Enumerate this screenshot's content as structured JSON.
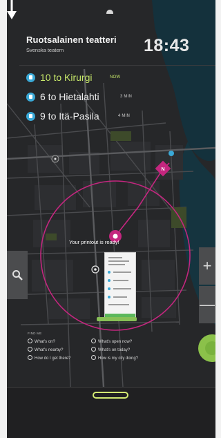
{
  "header": {
    "stop_name": "Ruotsalainen teatteri",
    "stop_name_sv": "Svenska teatern",
    "time": "18:43"
  },
  "departures": [
    {
      "line": "10 to Kirurgi",
      "when": "NOW",
      "mode": "tram"
    },
    {
      "line": "6 to Hietalahti",
      "when": "3 MIN",
      "mode": "tram"
    },
    {
      "line": "9 to Itä-Pasila",
      "when": "4 MIN",
      "mode": "tram"
    }
  ],
  "print": {
    "message": "Your printout is ready!"
  },
  "zoom": {
    "in_label": "+",
    "out_label": "—"
  },
  "help": {
    "title": "FIND ME",
    "items": [
      "What's on?",
      "What's nearby?",
      "How do I get there?",
      "What's open now?",
      "What's on today?",
      "How is my city doing?"
    ]
  },
  "colors": {
    "accent_green": "#c7e86a",
    "tram_blue": "#3aa9d7",
    "route_magenta": "#c4267f",
    "water": "#14313c"
  },
  "icons": {
    "search": "search-icon",
    "tram": "tram-icon",
    "north": "north-marker-icon",
    "arrow": "arrow-down-icon"
  }
}
